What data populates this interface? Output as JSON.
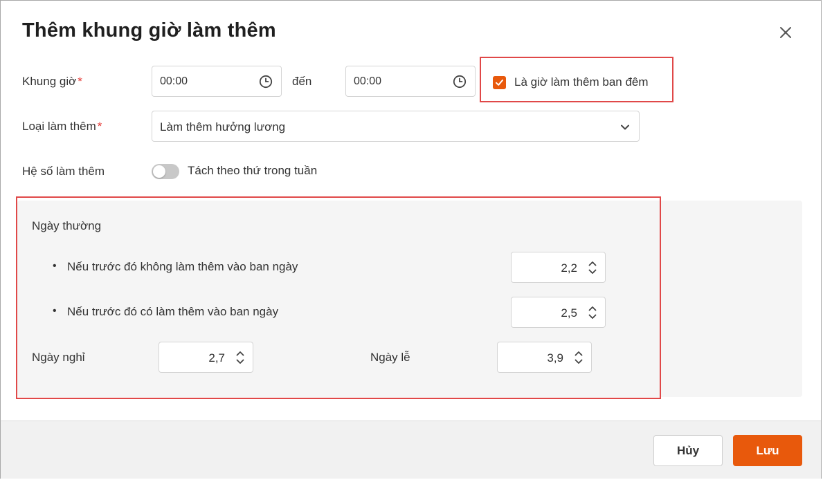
{
  "dialog": {
    "title": "Thêm khung giờ làm thêm"
  },
  "time_range": {
    "label": "Khung giờ",
    "required_mark": "*",
    "from_value": "00:00",
    "separator": "đến",
    "to_value": "00:00"
  },
  "night_overtime": {
    "checked": true,
    "label": "Là giờ làm thêm ban đêm"
  },
  "overtime_type": {
    "label": "Loại làm thêm",
    "required_mark": "*",
    "selected": "Làm thêm hưởng lương"
  },
  "coefficient": {
    "label": "Hệ số làm thêm",
    "toggle_on": false,
    "toggle_label": "Tách theo thứ trong tuần"
  },
  "panel": {
    "weekday_heading": "Ngày thường",
    "no_daytime_label": "Nếu trước đó không làm thêm vào ban ngày",
    "no_daytime_value": "2,2",
    "with_daytime_label": "Nếu trước đó có làm thêm vào ban ngày",
    "with_daytime_value": "2,5",
    "dayoff_label": "Ngày nghỉ",
    "dayoff_value": "2,7",
    "holiday_label": "Ngày lễ",
    "holiday_value": "3,9"
  },
  "footer": {
    "cancel_label": "Hủy",
    "save_label": "Lưu"
  },
  "colors": {
    "accent": "#e8590c",
    "highlight_border": "#e04848",
    "required": "#e53935"
  }
}
